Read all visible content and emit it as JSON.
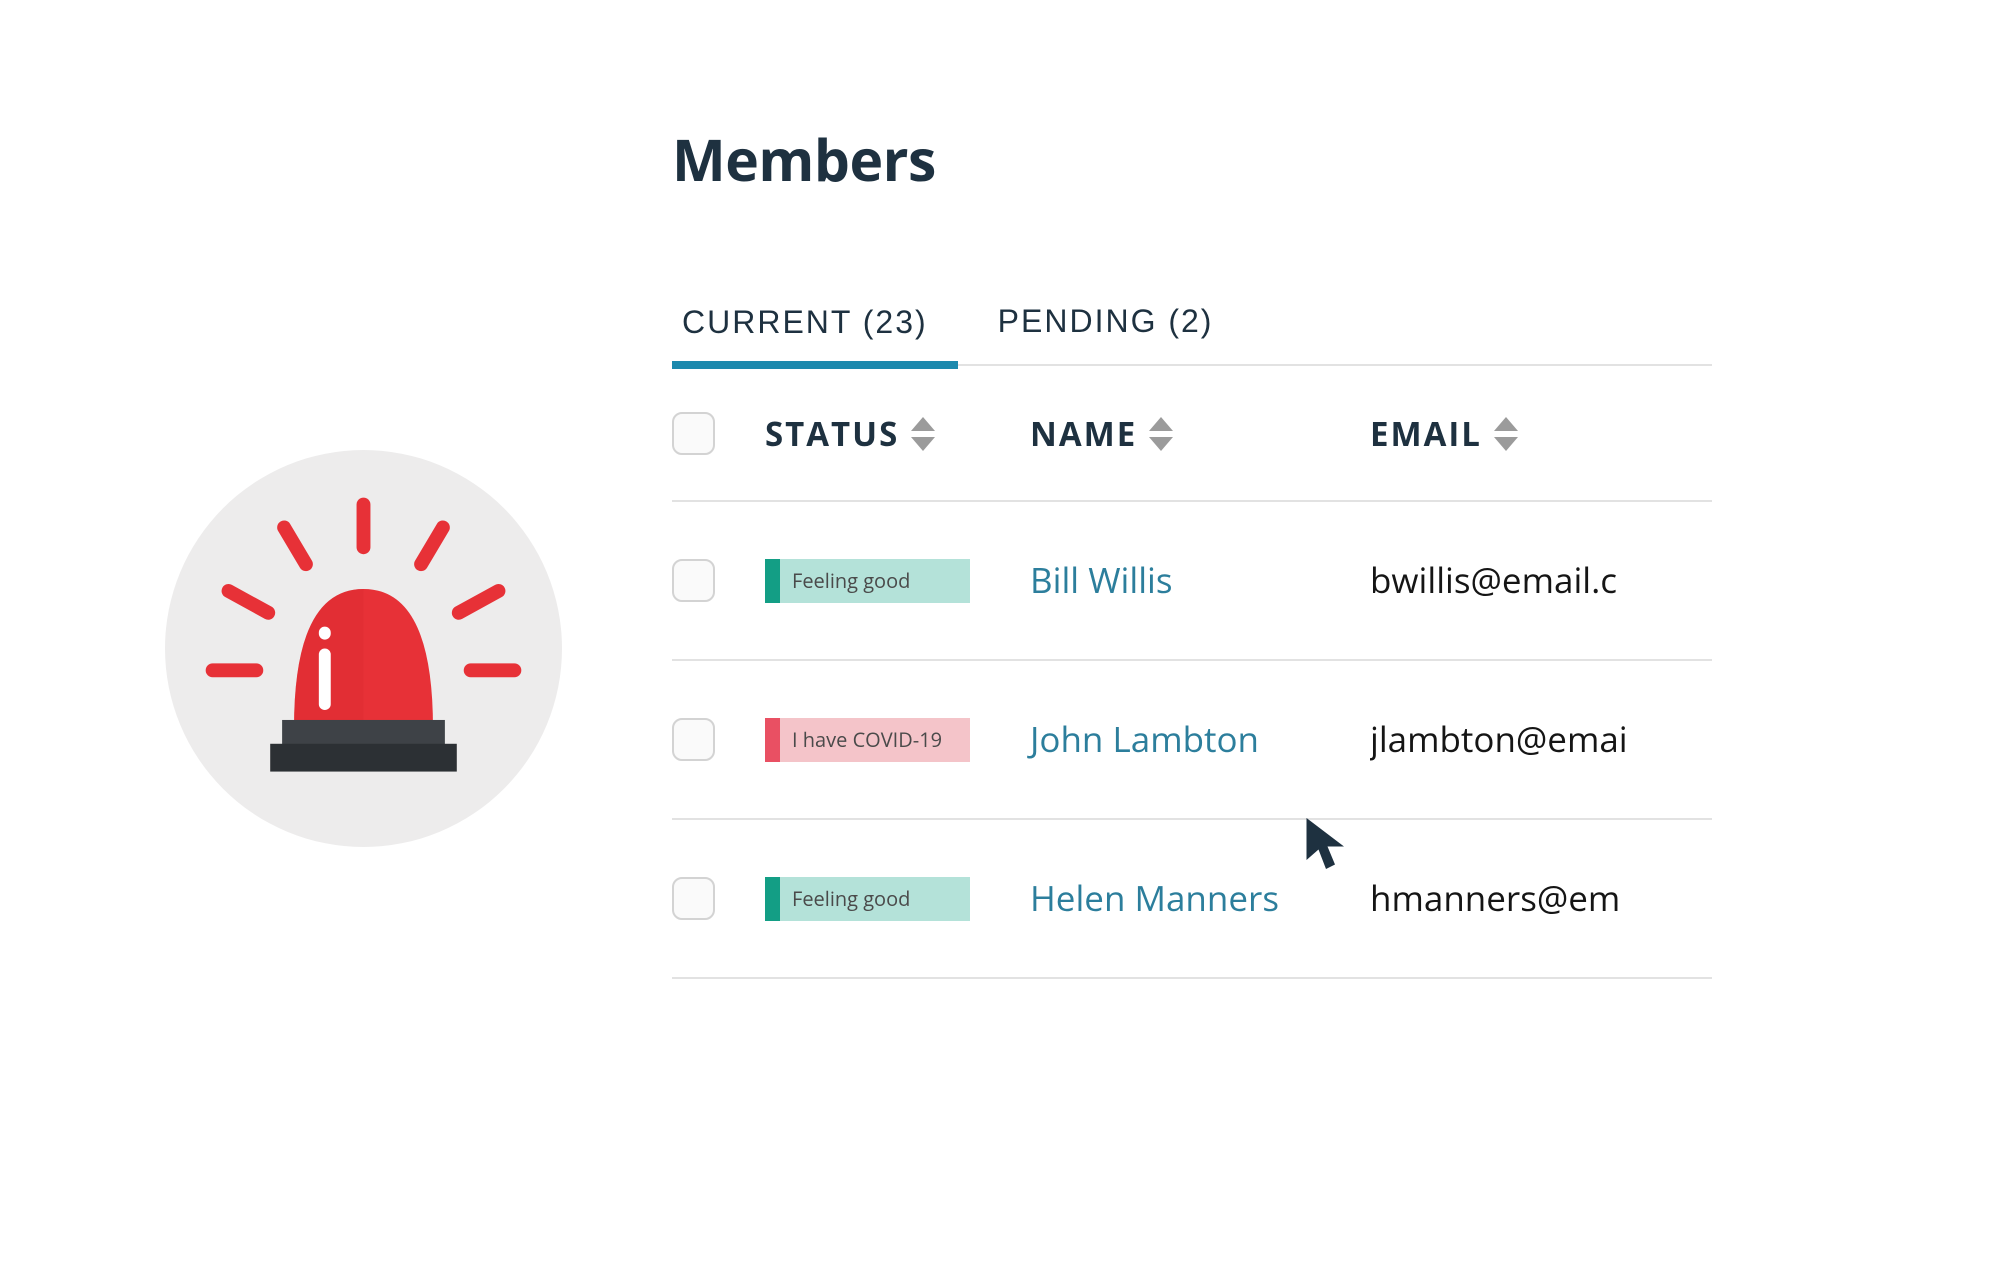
{
  "title": "Members",
  "tabs": [
    {
      "label": "CURRENT (23)",
      "active": true
    },
    {
      "label": "PENDING (2)",
      "active": false
    }
  ],
  "columns": {
    "status": "STATUS",
    "name": "NAME",
    "email": "EMAIL"
  },
  "statuses": {
    "good": {
      "label": "Feeling good",
      "variant": "good"
    },
    "covid": {
      "label": "I have COVID-19",
      "variant": "bad"
    }
  },
  "rows": [
    {
      "status_ref": "good",
      "name": "Bill Willis",
      "email": "bwillis@email.c"
    },
    {
      "status_ref": "covid",
      "name": "John Lambton",
      "email": "jlambton@emai"
    },
    {
      "status_ref": "good",
      "name": "Helen Manners",
      "email": "hmanners@em"
    }
  ],
  "colors": {
    "accent": "#1c89ad",
    "text_dark": "#1e3140",
    "link": "#2c7e9c",
    "alarm_red": "#e73137",
    "alarm_base": "#35393d"
  }
}
